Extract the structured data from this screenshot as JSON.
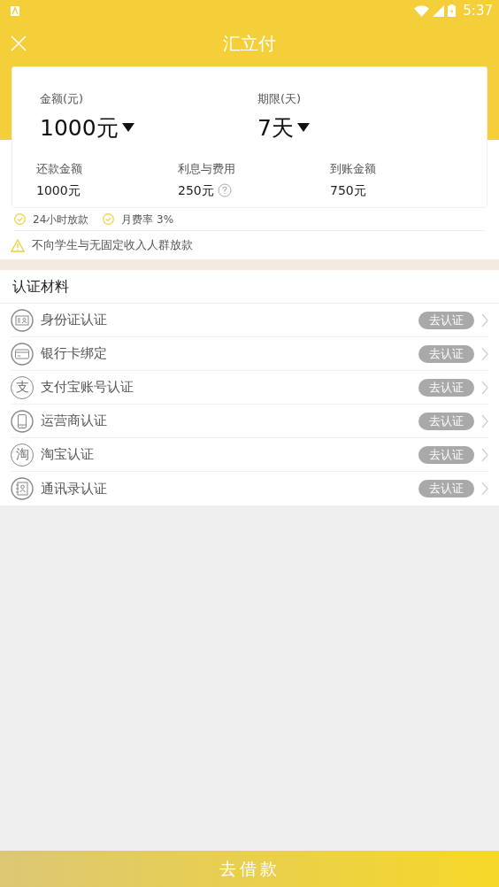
{
  "status_bar": {
    "time": "5:37"
  },
  "header": {
    "title": "汇立付"
  },
  "loan": {
    "amount": {
      "label": "金额(元)",
      "value": "1000元"
    },
    "term": {
      "label": "期限(天)",
      "value": "7天"
    },
    "summary": [
      {
        "label": "还款金额",
        "value": "1000元",
        "help": false
      },
      {
        "label": "利息与费用",
        "value": "250元",
        "help": true
      },
      {
        "label": "到账金额",
        "value": "750元",
        "help": false
      }
    ]
  },
  "features": [
    "24小时放款",
    "月费率 3%"
  ],
  "notice": "不向学生与无固定收入人群放款",
  "materials": {
    "title": "认证材料",
    "items": [
      {
        "kind": "id",
        "label": "身份证认证",
        "action": "去认证"
      },
      {
        "kind": "card",
        "label": "银行卡绑定",
        "action": "去认证"
      },
      {
        "kind": "glyph",
        "glyph": "支",
        "label": "支付宝账号认证",
        "action": "去认证"
      },
      {
        "kind": "phone",
        "label": "运营商认证",
        "action": "去认证"
      },
      {
        "kind": "glyph",
        "glyph": "淘",
        "label": "淘宝认证",
        "action": "去认证"
      },
      {
        "kind": "contacts",
        "label": "通讯录认证",
        "action": "去认证"
      }
    ]
  },
  "submit": "去借款"
}
